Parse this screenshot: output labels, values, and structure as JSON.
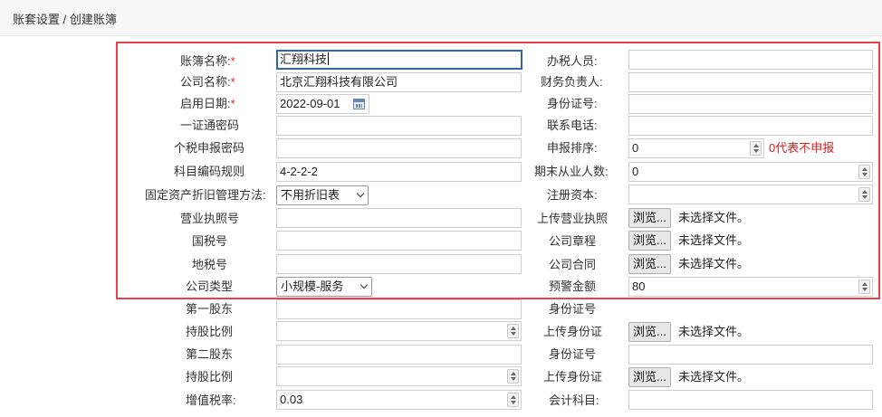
{
  "breadcrumb": "账套设置 / 创建账簿",
  "fields": {
    "book_name": {
      "label": "账簿名称:",
      "required": "*",
      "value": "汇翔科技"
    },
    "company_name": {
      "label": "公司名称:",
      "required": "*",
      "value": "北京汇翔科技有限公司"
    },
    "start_date": {
      "label": "启用日期:",
      "required": "*",
      "value": "2022-09-01"
    },
    "one_pass_password": {
      "label": "一证通密码",
      "value": ""
    },
    "iit_password": {
      "label": "个税申报密码",
      "value": ""
    },
    "account_code_rule": {
      "label": "科目编码规则",
      "value": "4-2-2-2"
    },
    "depreciation_method": {
      "label": "固定资产折旧管理方法:",
      "value": "不用折旧表"
    },
    "business_license_no": {
      "label": "营业执照号",
      "value": ""
    },
    "national_tax_no": {
      "label": "国税号",
      "value": ""
    },
    "local_tax_no": {
      "label": "地税号",
      "value": ""
    },
    "company_type": {
      "label": "公司类型",
      "value": "小规模-服务"
    },
    "first_shareholder": {
      "label": "第一股东",
      "value": ""
    },
    "share_ratio_1": {
      "label": "持股比例",
      "value": ""
    },
    "second_shareholder": {
      "label": "第二股东",
      "value": ""
    },
    "share_ratio_2": {
      "label": "持股比例",
      "value": ""
    },
    "vat_rate": {
      "label": "增值税率:",
      "value": "0.03"
    },
    "tax_officer": {
      "label": "办税人员:",
      "value": ""
    },
    "finance_manager": {
      "label": "财务负责人:",
      "value": ""
    },
    "id_number": {
      "label": "身份证号:",
      "value": ""
    },
    "contact_phone": {
      "label": "联系电话:",
      "value": ""
    },
    "filing_order": {
      "label": "申报排序:",
      "value": "0",
      "hint": "0代表不申报"
    },
    "employee_count": {
      "label": "期末从业人数:",
      "value": "0"
    },
    "registered_capital": {
      "label": "注册资本:",
      "value": ""
    },
    "upload_license": {
      "label": "上传营业执照"
    },
    "articles": {
      "label": "公司章程"
    },
    "contract": {
      "label": "公司合同"
    },
    "warning_amount": {
      "label": "预警金额",
      "value": "80"
    },
    "id_number_1": {
      "label": "身份证号"
    },
    "upload_id_1": {
      "label": "上传身份证"
    },
    "id_number_2": {
      "label": "身份证号"
    },
    "upload_id_2": {
      "label": "上传身份证"
    },
    "accounting_subject": {
      "label": "会计科目:",
      "value": ""
    }
  },
  "file": {
    "browse_label": "浏览...",
    "no_file_label": "未选择文件。"
  }
}
